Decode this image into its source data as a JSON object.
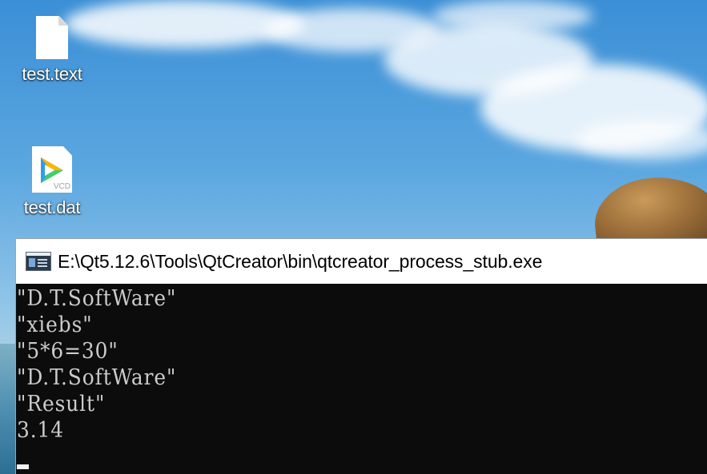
{
  "desktop": {
    "icons": [
      {
        "label": "test.text",
        "icon": "text-file-icon"
      },
      {
        "label": "test.dat",
        "icon": "video-file-icon",
        "badge": "VCD"
      }
    ]
  },
  "console": {
    "title": "E:\\Qt5.12.6\\Tools\\QtCreator\\bin\\qtcreator_process_stub.exe",
    "lines": [
      "\"D.T.SoftWare\"",
      "\"xiebs\"",
      "\"5*6=30\"",
      "\"D.T.SoftWare\"",
      "\"Result\"",
      "3.14"
    ],
    "colors": {
      "background": "#0c0c0c",
      "text": "#cccccc",
      "titlebar": "#ffffff"
    }
  }
}
